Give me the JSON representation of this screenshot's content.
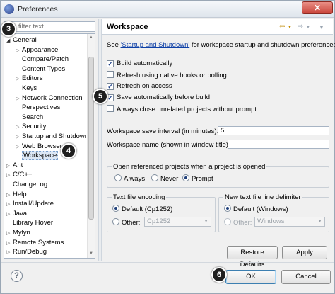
{
  "window": {
    "title": "Preferences",
    "close_label": "✕"
  },
  "filter": {
    "placeholder": "type filter text",
    "value": "e filter text"
  },
  "tree": {
    "items": [
      {
        "label": "General",
        "expanded": true
      },
      {
        "label": "Appearance",
        "expanded": false
      },
      {
        "label": "Compare/Patch"
      },
      {
        "label": "Content Types"
      },
      {
        "label": "Editors",
        "expanded": false
      },
      {
        "label": "Keys"
      },
      {
        "label": "Network Connection",
        "expanded": false
      },
      {
        "label": "Perspectives"
      },
      {
        "label": "Search"
      },
      {
        "label": "Security",
        "expanded": false
      },
      {
        "label": "Startup and Shutdown",
        "expanded": false
      },
      {
        "label": "Web Browser",
        "expanded": false
      },
      {
        "label": "Workspace",
        "selected": true
      },
      {
        "label": "Ant",
        "expanded": false
      },
      {
        "label": "C/C++",
        "expanded": false
      },
      {
        "label": "ChangeLog"
      },
      {
        "label": "Help",
        "expanded": false
      },
      {
        "label": "Install/Update",
        "expanded": false
      },
      {
        "label": "Java",
        "expanded": false
      },
      {
        "label": "Library Hover"
      },
      {
        "label": "Mylyn",
        "expanded": false
      },
      {
        "label": "Remote Systems",
        "expanded": false
      },
      {
        "label": "Run/Debug",
        "expanded": false
      }
    ]
  },
  "page": {
    "title": "Workspace",
    "description_prefix": "See ",
    "description_link": "'Startup and Shutdown'",
    "description_suffix": " for workspace startup and shutdown preferences.",
    "checkboxes": [
      {
        "label": "Build automatically",
        "checked": true
      },
      {
        "label": "Refresh using native hooks or polling",
        "checked": false
      },
      {
        "label": "Refresh on access",
        "checked": true
      },
      {
        "label": "Save automatically before build",
        "checked": true
      },
      {
        "label": "Always close unrelated projects without prompt",
        "checked": false
      }
    ],
    "save_interval_label": "Workspace save interval (in minutes):",
    "save_interval_value": "5",
    "workspace_name_label": "Workspace name (shown in window title):",
    "workspace_name_value": "",
    "open_projects": {
      "title": "Open referenced projects when a project is opened",
      "options": [
        "Always",
        "Never",
        "Prompt"
      ],
      "selected": "Prompt"
    },
    "encoding": {
      "title": "Text file encoding",
      "default_label": "Default (Cp1252)",
      "other_label": "Other:",
      "other_value": "Cp1252"
    },
    "line_delimiter": {
      "title": "New text file line delimiter",
      "default_label": "Default (Windows)",
      "other_label": "Other:",
      "other_value": "Windows"
    },
    "restore_defaults_label": "Restore Defaults",
    "apply_label": "Apply"
  },
  "footer": {
    "help_label": "?",
    "ok_label": "OK",
    "cancel_label": "Cancel"
  },
  "callouts": {
    "c3": "3",
    "c4": "4",
    "c5": "5",
    "c6": "6"
  }
}
